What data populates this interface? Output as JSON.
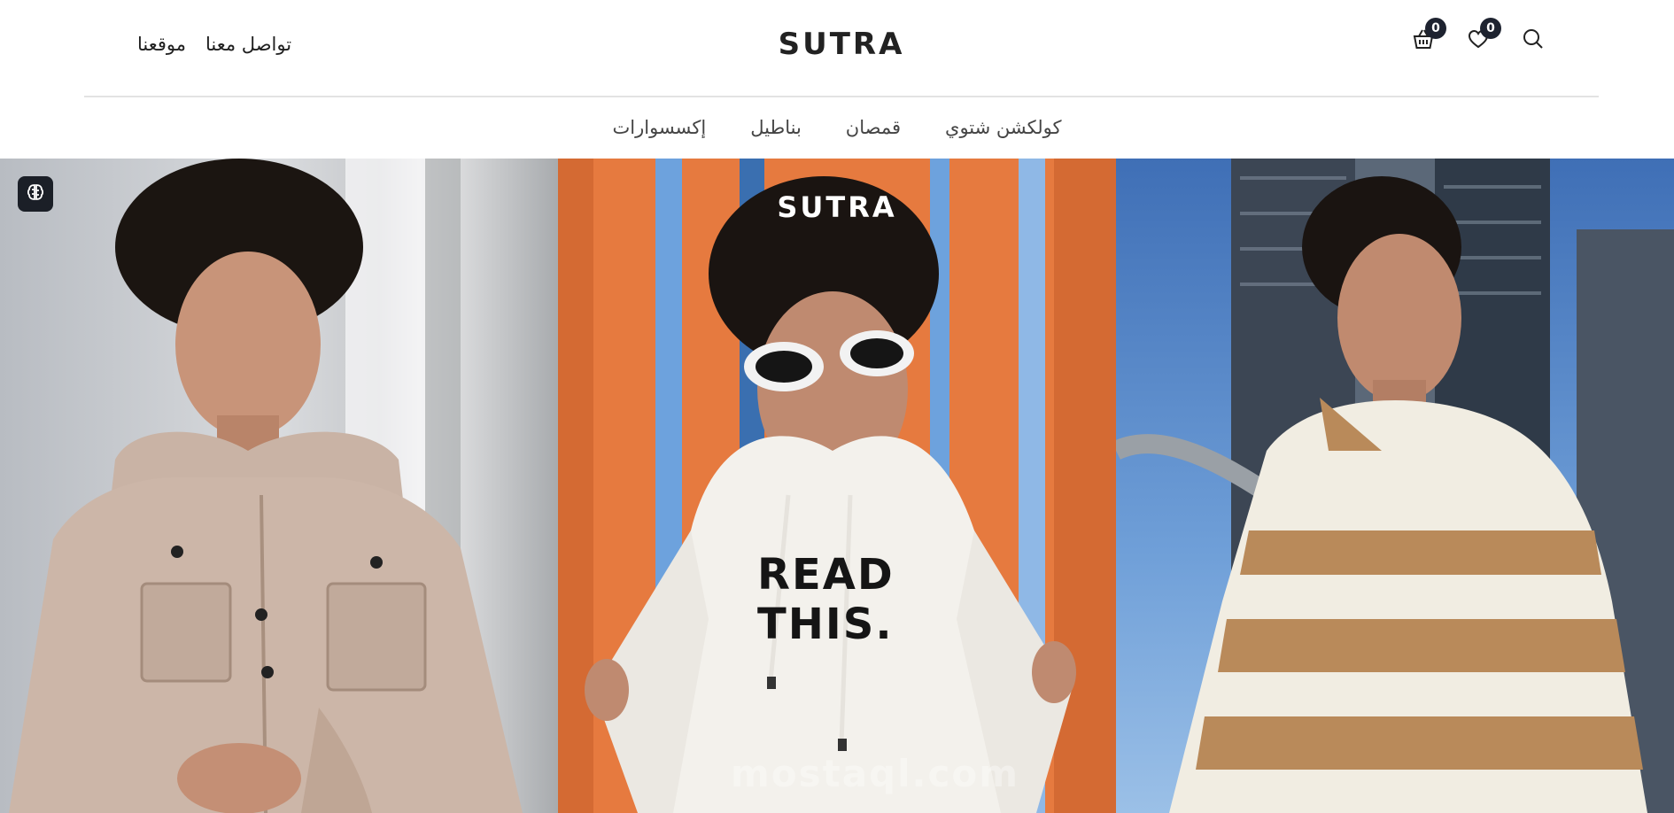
{
  "header": {
    "top_links": [
      {
        "label": "تواصل معنا"
      },
      {
        "label": "موقعنا"
      }
    ],
    "logo": "SUTRA",
    "cart_count": "0",
    "wishlist_count": "0",
    "icons": [
      "search-icon",
      "heart-icon",
      "basket-icon"
    ]
  },
  "nav": {
    "items": [
      {
        "label": "كولكشن شتوي"
      },
      {
        "label": "قمصان"
      },
      {
        "label": "بناطيل"
      },
      {
        "label": "إكسسوارات"
      }
    ]
  },
  "hero": {
    "logo": "SUTRA",
    "shirt_line1": "READ",
    "shirt_line2": "THIS.",
    "watermark": "mostaql.com",
    "panels": [
      "beige-jacket-model",
      "white-hoodie-model",
      "striped-sweater-model"
    ]
  },
  "colors": {
    "badge": "#1e2330",
    "panel2_bg": "#e67a3f",
    "sweater_stripe": "#b98a5a"
  }
}
